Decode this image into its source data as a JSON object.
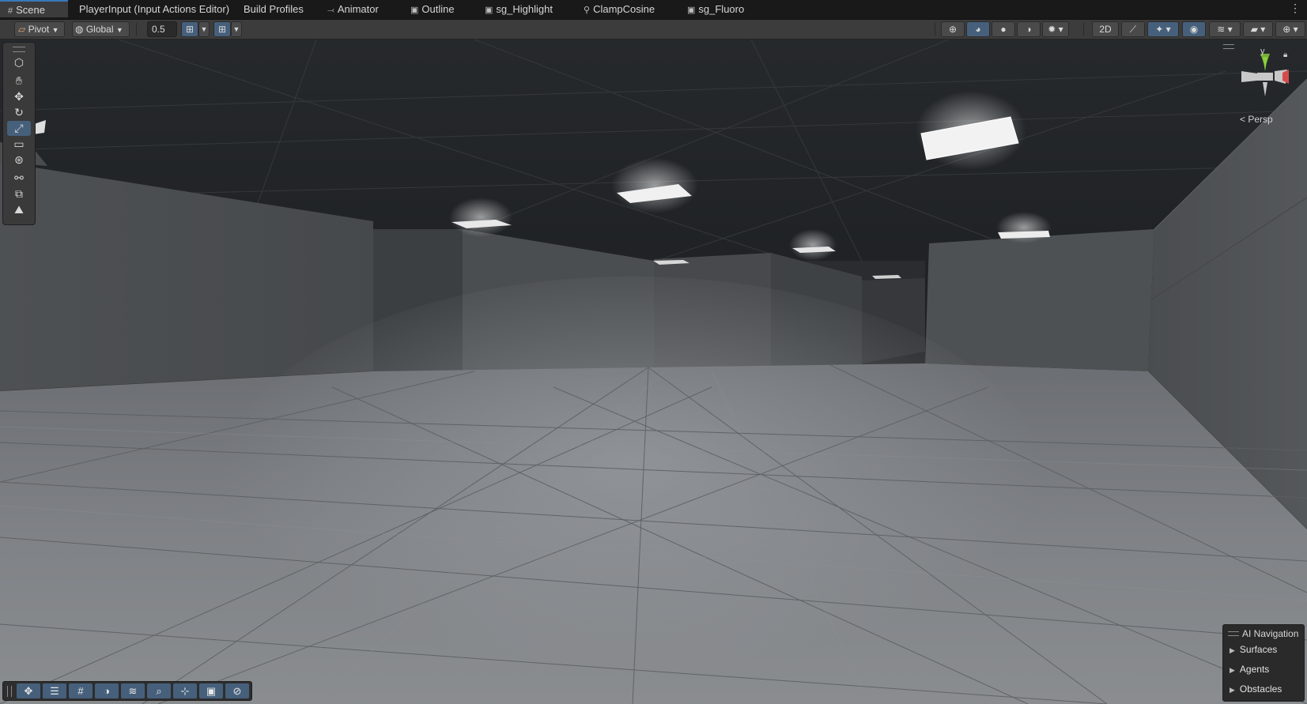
{
  "tabs": [
    {
      "label": "Scene",
      "icon": "scene-grid-icon",
      "active": true
    },
    {
      "label": "PlayerInput (Input Actions Editor)",
      "icon": "",
      "active": false
    },
    {
      "label": "Build Profiles",
      "icon": "",
      "active": false
    },
    {
      "label": "Animator",
      "icon": "animator-icon",
      "active": false
    },
    {
      "label": "Outline",
      "icon": "shader-graph-icon",
      "active": false
    },
    {
      "label": "sg_Highlight",
      "icon": "shader-graph-icon",
      "active": false
    },
    {
      "label": "ClampCosine",
      "icon": "subgraph-icon",
      "active": false
    },
    {
      "label": "sg_Fluoro",
      "icon": "shader-graph-icon",
      "active": false
    }
  ],
  "toolbar": {
    "pivot_label": "Pivot",
    "global_label": "Global",
    "snap_value": "0.5"
  },
  "gizmo": {
    "axis_y": "y",
    "projection_label": "< Persp"
  },
  "ai_navigation": {
    "title": "AI Navigation",
    "items": [
      "Surfaces",
      "Agents",
      "Obstacles"
    ]
  },
  "tools": [
    "view-tool",
    "hand-icon",
    "move-icon",
    "rotate-icon",
    "scale-icon",
    "rect-icon",
    "transform-icon",
    "custom-tool-icon",
    "box-collider-icon",
    "probe-icon"
  ],
  "bottom_overlays": [
    "move-overlay-icon",
    "inspector-overlay-icon",
    "grid-overlay-icon",
    "lighting-overlay-icon",
    "layers-overlay-icon",
    "search-overlay-icon",
    "pivot-overlay-icon",
    "camera-overlay-icon",
    "compass-overlay-icon"
  ]
}
